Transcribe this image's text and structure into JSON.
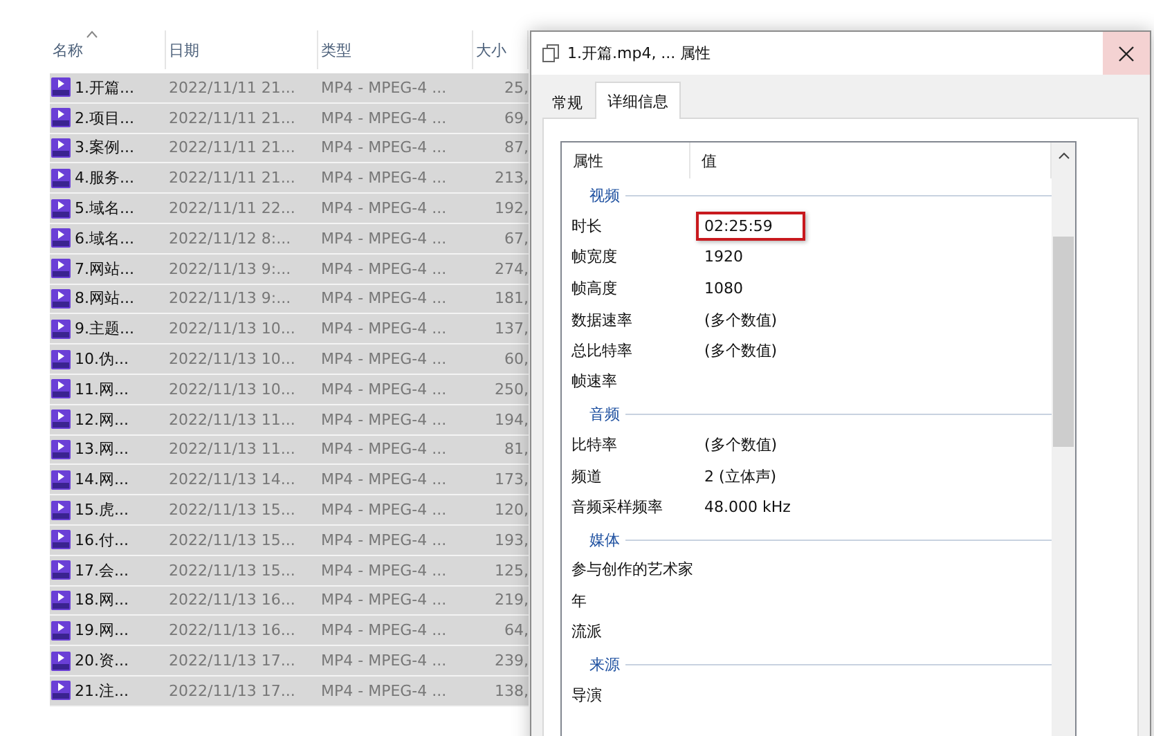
{
  "file_list": {
    "columns": [
      {
        "label": "名称",
        "sorted": true
      },
      {
        "label": "日期",
        "sorted": false
      },
      {
        "label": "类型",
        "sorted": false
      },
      {
        "label": "大小",
        "sorted": false
      }
    ],
    "rows": [
      {
        "name": "1.开篇...",
        "date": "2022/11/11 21...",
        "type": "MP4 - MPEG-4 ...",
        "size": "25,",
        "selected": true
      },
      {
        "name": "2.项目...",
        "date": "2022/11/11 21...",
        "type": "MP4 - MPEG-4 ...",
        "size": "69,",
        "selected": true
      },
      {
        "name": "3.案例...",
        "date": "2022/11/11 21...",
        "type": "MP4 - MPEG-4 ...",
        "size": "87,",
        "selected": true
      },
      {
        "name": "4.服务...",
        "date": "2022/11/11 21...",
        "type": "MP4 - MPEG-4 ...",
        "size": "213,",
        "selected": true
      },
      {
        "name": "5.域名...",
        "date": "2022/11/11 22...",
        "type": "MP4 - MPEG-4 ...",
        "size": "192,",
        "selected": true
      },
      {
        "name": "6.域名...",
        "date": "2022/11/12 8:...",
        "type": "MP4 - MPEG-4 ...",
        "size": "67,",
        "selected": true
      },
      {
        "name": "7.网站...",
        "date": "2022/11/13 9:...",
        "type": "MP4 - MPEG-4 ...",
        "size": "274,",
        "selected": true
      },
      {
        "name": "8.网站...",
        "date": "2022/11/13 9:...",
        "type": "MP4 - MPEG-4 ...",
        "size": "181,",
        "selected": true
      },
      {
        "name": "9.主题...",
        "date": "2022/11/13 10...",
        "type": "MP4 - MPEG-4 ...",
        "size": "137,",
        "selected": true
      },
      {
        "name": "10.伪...",
        "date": "2022/11/13 10...",
        "type": "MP4 - MPEG-4 ...",
        "size": "60,",
        "selected": true
      },
      {
        "name": "11.网...",
        "date": "2022/11/13 10...",
        "type": "MP4 - MPEG-4 ...",
        "size": "250,",
        "selected": true
      },
      {
        "name": "12.网...",
        "date": "2022/11/13 11...",
        "type": "MP4 - MPEG-4 ...",
        "size": "194,",
        "selected": true
      },
      {
        "name": "13.网...",
        "date": "2022/11/13 11...",
        "type": "MP4 - MPEG-4 ...",
        "size": "81,",
        "selected": true
      },
      {
        "name": "14.网...",
        "date": "2022/11/13 14...",
        "type": "MP4 - MPEG-4 ...",
        "size": "173,",
        "selected": true
      },
      {
        "name": "15.虎...",
        "date": "2022/11/13 15...",
        "type": "MP4 - MPEG-4 ...",
        "size": "120,",
        "selected": true
      },
      {
        "name": "16.付...",
        "date": "2022/11/13 15...",
        "type": "MP4 - MPEG-4 ...",
        "size": "193,",
        "selected": true
      },
      {
        "name": "17.会...",
        "date": "2022/11/13 15...",
        "type": "MP4 - MPEG-4 ...",
        "size": "125,",
        "selected": true
      },
      {
        "name": "18.网...",
        "date": "2022/11/13 16...",
        "type": "MP4 - MPEG-4 ...",
        "size": "219,",
        "selected": true
      },
      {
        "name": "19.网...",
        "date": "2022/11/13 16...",
        "type": "MP4 - MPEG-4 ...",
        "size": "64,",
        "selected": true
      },
      {
        "name": "20.资...",
        "date": "2022/11/13 17...",
        "type": "MP4 - MPEG-4 ...",
        "size": "239,",
        "selected": true
      },
      {
        "name": "21.注...",
        "date": "2022/11/13 17...",
        "type": "MP4 - MPEG-4 ...",
        "size": "138,",
        "selected": true
      }
    ]
  },
  "dialog": {
    "title": "1.开篇.mp4, ... 属性",
    "tabs": [
      {
        "label": "常规",
        "selected": false
      },
      {
        "label": "详细信息",
        "selected": true
      }
    ],
    "columns": [
      "属性",
      "值"
    ],
    "properties": [
      {
        "kind": "group",
        "label": "视频"
      },
      {
        "kind": "property",
        "label": "时长",
        "value": "02:25:59",
        "highlighted": true
      },
      {
        "kind": "property",
        "label": "帧宽度",
        "value": "1920",
        "highlighted": false
      },
      {
        "kind": "property",
        "label": "帧高度",
        "value": "1080",
        "highlighted": false
      },
      {
        "kind": "property",
        "label": "数据速率",
        "value": "(多个数值)",
        "highlighted": false
      },
      {
        "kind": "property",
        "label": "总比特率",
        "value": "(多个数值)",
        "highlighted": false
      },
      {
        "kind": "property",
        "label": "帧速率"
      },
      {
        "kind": "group",
        "label": "音频"
      },
      {
        "kind": "property",
        "label": "比特率",
        "value": "(多个数值)",
        "highlighted": false
      },
      {
        "kind": "property",
        "label": "频道",
        "value": "2 (立体声)",
        "highlighted": false
      },
      {
        "kind": "property",
        "label": "音频采样频率",
        "value": "48.000 kHz",
        "highlighted": false
      },
      {
        "kind": "group",
        "label": "媒体"
      },
      {
        "kind": "property",
        "label": "参与创作的艺术家"
      },
      {
        "kind": "property",
        "label": "年"
      },
      {
        "kind": "property",
        "label": "流派"
      },
      {
        "kind": "group",
        "label": "来源"
      },
      {
        "kind": "property",
        "label": "导演"
      }
    ]
  }
}
